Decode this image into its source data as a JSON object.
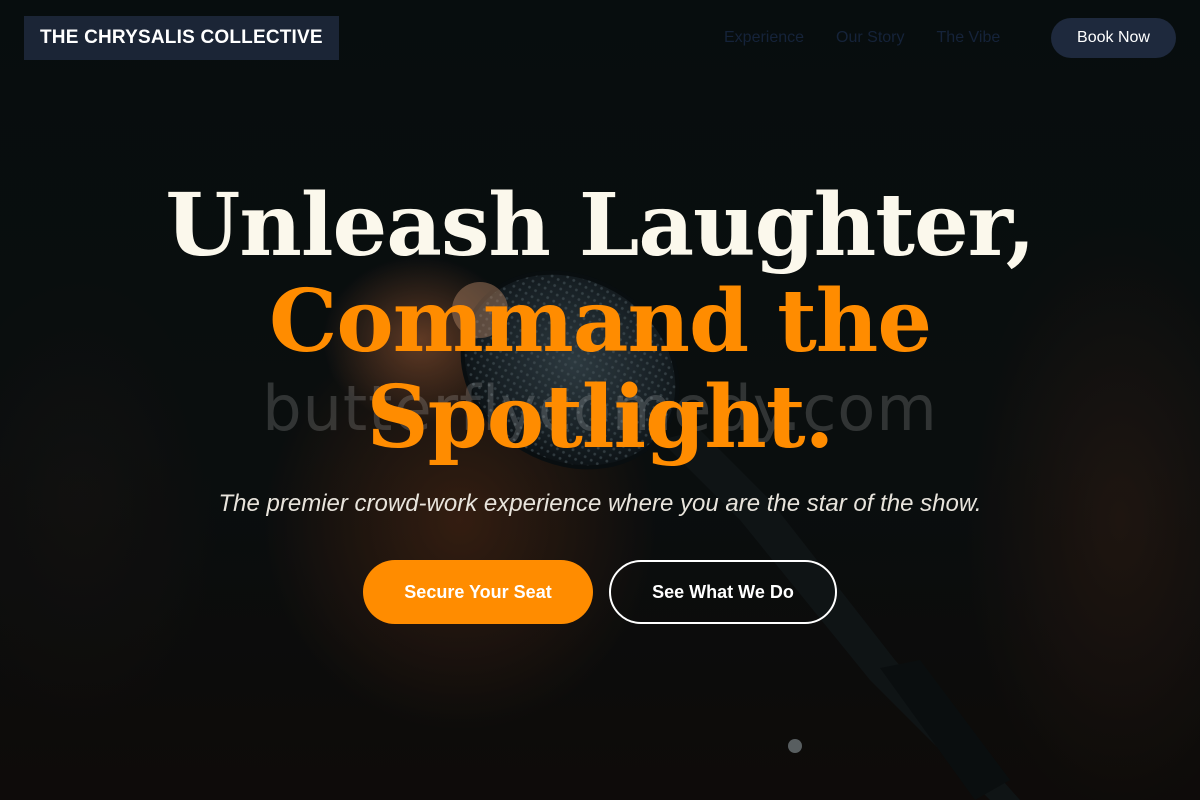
{
  "header": {
    "brand": "THE CHRYSALIS COLLECTIVE",
    "nav": [
      {
        "label": "Experience"
      },
      {
        "label": "Our Story"
      },
      {
        "label": "The Vibe"
      }
    ],
    "book_label": "Book Now"
  },
  "watermark": "butterflycomedy.com",
  "hero": {
    "headline_line1": "Unleash Laughter,",
    "headline_line2": "Command the Spotlight.",
    "subtitle": "The premier crowd-work experience where you are the star of the show.",
    "primary_cta": "Secure Your Seat",
    "secondary_cta": "See What We Do"
  },
  "colors": {
    "accent": "#ff8c00",
    "brand_bg": "#1b2536",
    "headline": "#fbf8ec"
  },
  "background": {
    "image": "microphone-on-stand"
  }
}
